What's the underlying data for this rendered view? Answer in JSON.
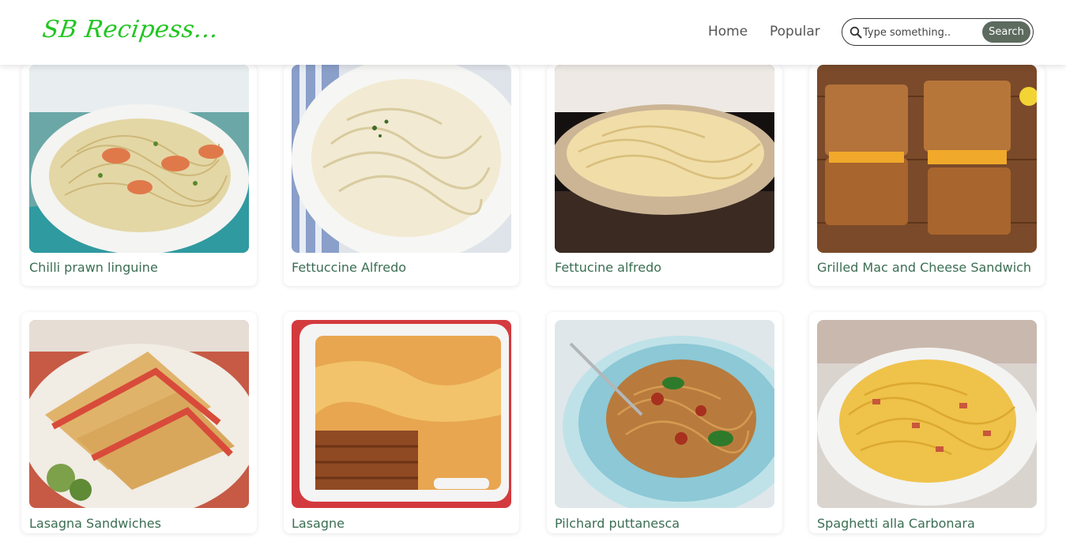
{
  "header": {
    "logo": "SB Recipess...",
    "nav": {
      "home": "Home",
      "popular": "Popular"
    },
    "search": {
      "placeholder": "Type something..",
      "button_label": "Search"
    }
  },
  "recipes": [
    {
      "title": "Chilli prawn linguine",
      "image": "pasta-with-prawns"
    },
    {
      "title": "Fettuccine Alfredo",
      "image": "creamy-fettuccine"
    },
    {
      "title": "Fettucine alfredo",
      "image": "fettuccine-dark-plate"
    },
    {
      "title": "Grilled Mac and Cheese Sandwich",
      "image": "grilled-sandwich"
    },
    {
      "title": "Lasagna Sandwiches",
      "image": "toasted-sandwich"
    },
    {
      "title": "Lasagne",
      "image": "baked-lasagne"
    },
    {
      "title": "Pilchard puttanesca",
      "image": "spaghetti-tomato"
    },
    {
      "title": "Spaghetti alla Carbonara",
      "image": "spaghetti-carbonara"
    }
  ],
  "colors": {
    "logo": "#22c522",
    "title": "#3b6e52",
    "search_button": "#5d6b5f"
  }
}
